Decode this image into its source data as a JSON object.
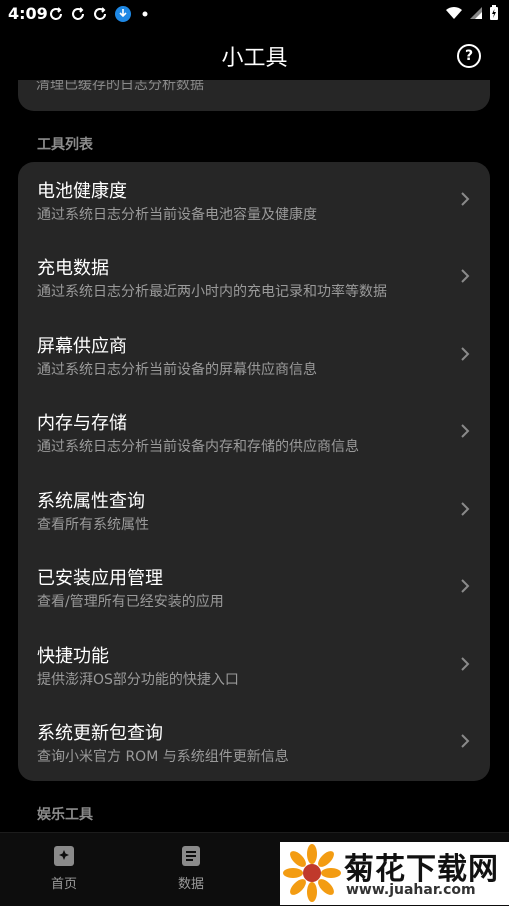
{
  "status": {
    "time": "4:09"
  },
  "appbar": {
    "title": "小工具",
    "help_label": "?"
  },
  "previous_card": {
    "subtitle_cut": "清理已缓存的日志分析数据"
  },
  "sections": {
    "tools": "工具列表",
    "entertainment": "娱乐工具"
  },
  "tools": [
    {
      "title": "电池健康度",
      "subtitle": "通过系统日志分析当前设备电池容量及健康度"
    },
    {
      "title": "充电数据",
      "subtitle": "通过系统日志分析最近两小时内的充电记录和功率等数据"
    },
    {
      "title": "屏幕供应商",
      "subtitle": "通过系统日志分析当前设备的屏幕供应商信息"
    },
    {
      "title": "内存与存储",
      "subtitle": "通过系统日志分析当前设备内存和存储的供应商信息"
    },
    {
      "title": "系统属性查询",
      "subtitle": "查看所有系统属性"
    },
    {
      "title": "已安装应用管理",
      "subtitle": "查看/管理所有已经安装的应用"
    },
    {
      "title": "快捷功能",
      "subtitle": "提供澎湃OS部分功能的快捷入口"
    },
    {
      "title": "系统更新包查询",
      "subtitle": "查询小米官方 ROM 与系统组件更新信息"
    }
  ],
  "bottom_nav": [
    {
      "label": "首页",
      "icon": "home-icon"
    },
    {
      "label": "数据",
      "icon": "document-icon"
    }
  ],
  "watermark": {
    "text": "菊花下载网",
    "url": "www.juahar.com"
  }
}
